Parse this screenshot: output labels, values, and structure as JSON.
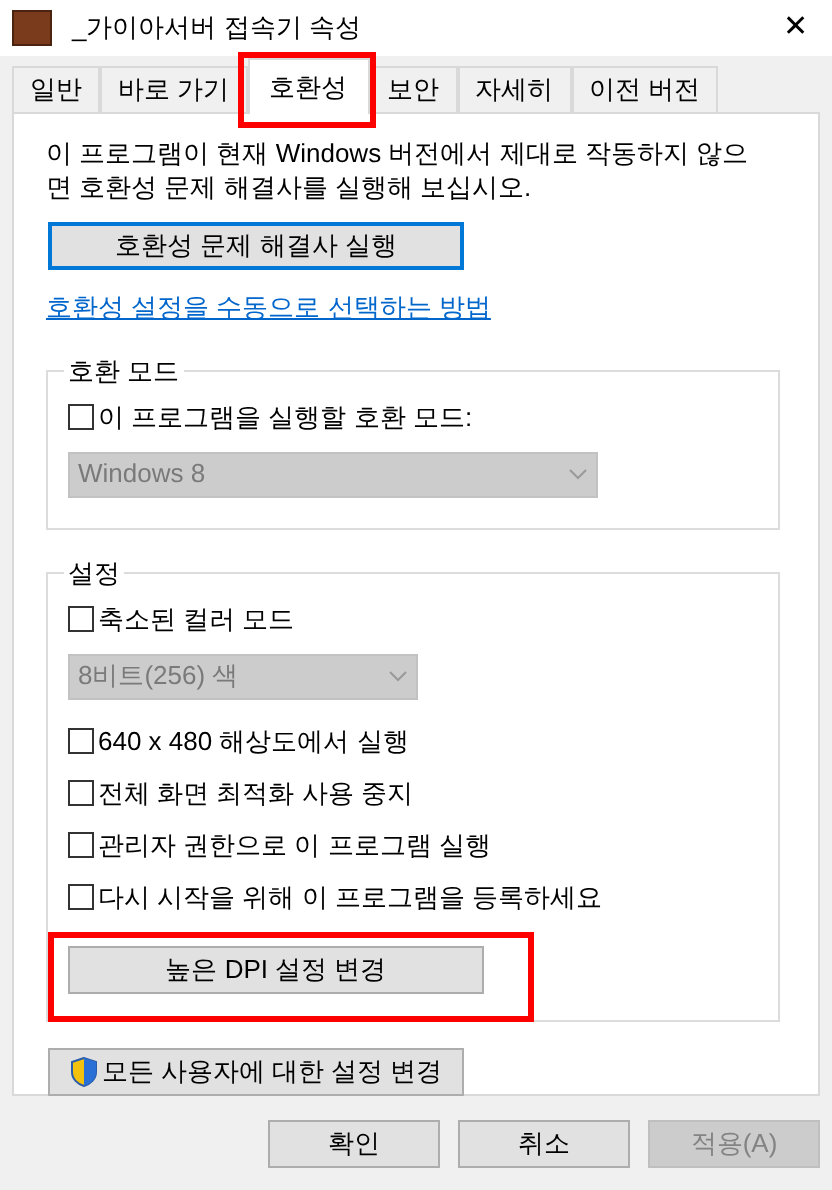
{
  "window": {
    "title": "_가이아서버 접속기 속성",
    "close": "✕"
  },
  "tabs": [
    {
      "label": "일반",
      "selected": false,
      "highlighted": false
    },
    {
      "label": "바로 가기",
      "selected": false,
      "highlighted": false
    },
    {
      "label": "호환성",
      "selected": true,
      "highlighted": true
    },
    {
      "label": "보안",
      "selected": false,
      "highlighted": false
    },
    {
      "label": "자세히",
      "selected": false,
      "highlighted": false
    },
    {
      "label": "이전 버전",
      "selected": false,
      "highlighted": false
    }
  ],
  "intro": "이 프로그램이 현재 Windows 버전에서 제대로 작동하지 않으면 호환성 문제 해결사를 실행해 보십시오.",
  "troubleshooter_button": {
    "label": "호환성 문제 해결사 실행",
    "focused": true
  },
  "manual_link": "호환성 설정을 수동으로 선택하는 방법",
  "groups": [
    {
      "title": "호환 모드",
      "items": [
        {
          "kind": "checkbox",
          "label": "이 프로그램을 실행할 호환 모드:",
          "checked": false
        },
        {
          "kind": "dropdown",
          "value": "Windows 8",
          "disabled": true,
          "wide": true
        }
      ]
    },
    {
      "title": "설정",
      "items": [
        {
          "kind": "checkbox",
          "label": "축소된 컬러 모드",
          "checked": false
        },
        {
          "kind": "dropdown",
          "value": "8비트(256) 색",
          "disabled": true,
          "wide": false
        },
        {
          "kind": "checkbox",
          "label": "640 x 480 해상도에서 실행",
          "checked": false
        },
        {
          "kind": "checkbox",
          "label": "전체 화면 최적화 사용 중지",
          "checked": false
        },
        {
          "kind": "checkbox",
          "label": "관리자 권한으로 이 프로그램 실행",
          "checked": false
        },
        {
          "kind": "checkbox",
          "label": "다시 시작을 위해 이 프로그램을 등록하세요",
          "checked": false
        },
        {
          "kind": "button",
          "label": "높은 DPI 설정 변경",
          "highlighted": true
        }
      ]
    }
  ],
  "all_users_button": {
    "label": "모든 사용자에 대한 설정 변경"
  },
  "buttons": [
    {
      "label": "확인",
      "disabled": false
    },
    {
      "label": "취소",
      "disabled": false
    },
    {
      "label": "적용(A)",
      "disabled": true
    }
  ]
}
